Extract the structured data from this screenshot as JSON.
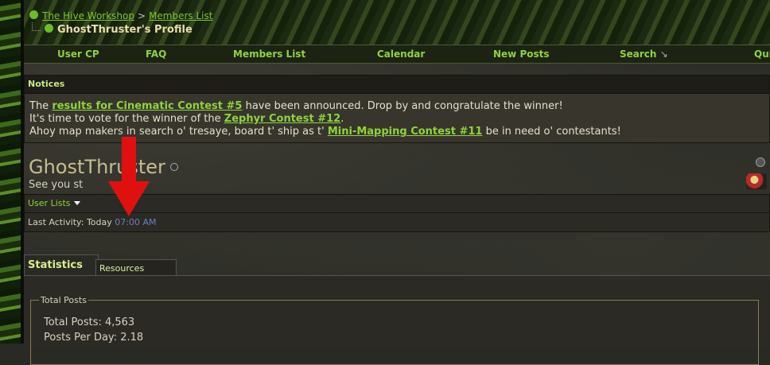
{
  "breadcrumb": {
    "home": "The Hive Workshop",
    "separator": ">",
    "members": "Members List"
  },
  "page_title": "GhostThruster's Profile",
  "navbar": [
    "User CP",
    "FAQ",
    "Members List",
    "Calendar",
    "New Posts",
    "Search",
    "Qui"
  ],
  "notices": {
    "header": "Notices",
    "line1_pre": "The ",
    "line1_link": "results for Cinematic Contest #5",
    "line1_post": " have been announced. Drop by and congratulate the winner!",
    "line2_pre": "It's time to vote for the winner of the ",
    "line2_link": "Zephyr Contest #12",
    "line2_post": ".",
    "line3_pre": "Ahoy map makers in search o' tresaye, board t' ship as t' ",
    "line3_link": "Mini-Mapping Contest #11",
    "line3_post": " be in need o' contestants!"
  },
  "profile": {
    "username": "GhostThruster",
    "user_title": "See you st",
    "user_lists": "User Lists",
    "last_activity_label": "Last Activity:",
    "last_activity_day": "Today",
    "last_activity_time": "07:00 AM"
  },
  "tabs": {
    "active": "Statistics",
    "other": "Resources"
  },
  "statistics": {
    "legend": "Total Posts",
    "total_posts": "Total Posts: 4,563",
    "posts_per_day": "Posts Per Day: 2.18"
  },
  "colors": {
    "link_green": "#8fd43a",
    "arrow_red": "#e01010",
    "time_blue": "#6f7fc0"
  }
}
